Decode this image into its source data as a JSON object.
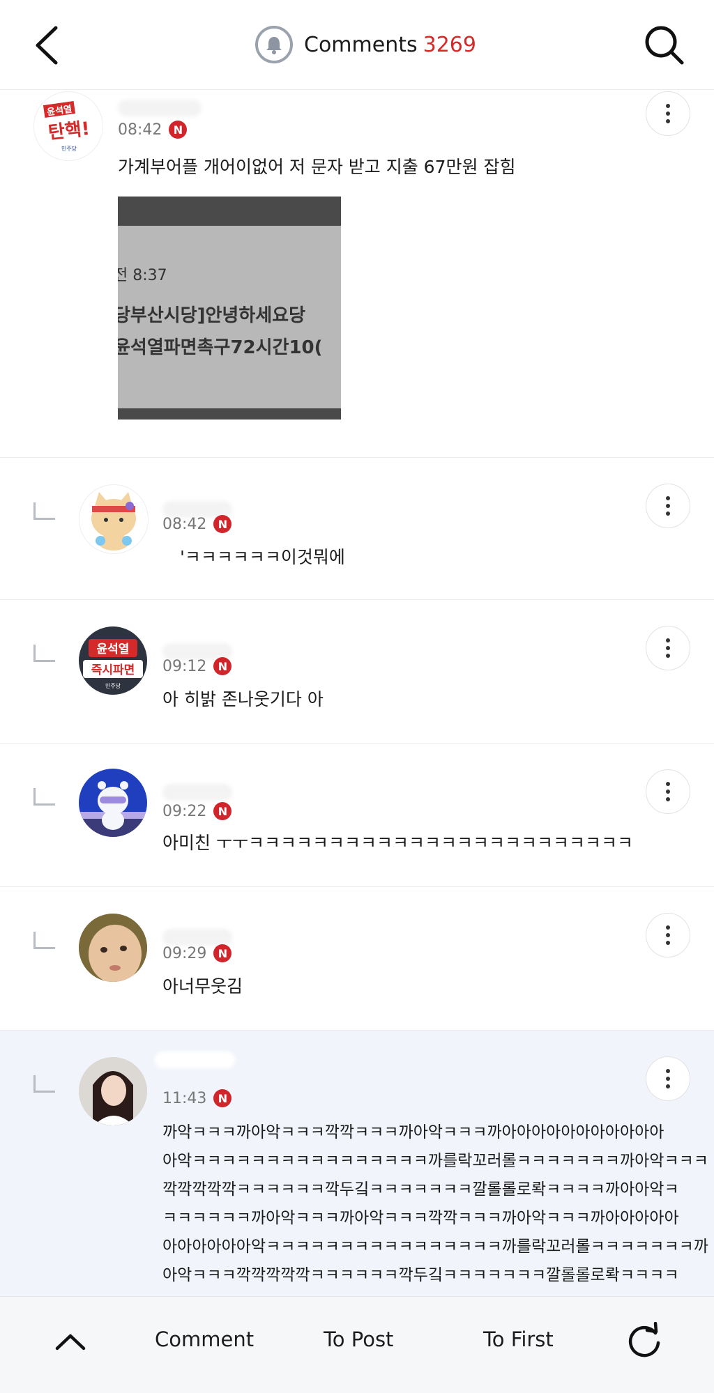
{
  "header": {
    "title": "Comments",
    "count": "3269"
  },
  "comments": [
    {
      "time": "08:42",
      "badge": "N",
      "text": "가계부어플 개어이없어 저 문자 받고 지출 67만원 잡힘",
      "image_lines": [
        "전 8:37",
        "당부산시당]안녕하세요당",
        "윤석열파면촉구72시간10("
      ],
      "avatar_text": [
        "윤석열",
        "탄핵!",
        "민주당"
      ]
    },
    {
      "time": "08:42",
      "badge": "N",
      "text": "'ㅋㅋㅋㅋㅋㅋ이것뭐에"
    },
    {
      "time": "09:12",
      "badge": "N",
      "text": "아 히밝 존나웃기다 아",
      "avatar_text": [
        "윤석열",
        "즉시파면",
        "민주당"
      ]
    },
    {
      "time": "09:22",
      "badge": "N",
      "text": "아미친 ㅜㅜㅋㅋㅋㅋㅋㅋㅋㅋㅋㅋㅋㅋㅋㅋㅋㅋㅋㅋㅋㅋㅋㅋㅋㅋ"
    },
    {
      "time": "09:29",
      "badge": "N",
      "text": "아너무웃김"
    },
    {
      "time": "11:43",
      "badge": "N",
      "lines": [
        "까악ㅋㅋㅋ까아악ㅋㅋㅋ깍깍ㅋㅋㅋ까아악ㅋㅋㅋ까아아아아아아아아아아아",
        "아악ㅋㅋㅋㅋㅋㅋㅋㅋㅋㅋㅋㅋㅋㅋㅋㅋ까를락꼬러롤ㅋㅋㅋㅋㅋㅋㅋ까아악ㅋㅋㅋ",
        "깍깍깍깍깍ㅋㅋㅋㅋㅋㅋ깍두깈ㅋㅋㅋㅋㅋㅋㅋ깔롤롤로롹ㅋㅋㅋㅋ까아아악ㅋ",
        "ㅋㅋㅋㅋㅋㅋ까아악ㅋㅋㅋ까아악ㅋㅋㅋ깍깍ㅋㅋㅋ까아악ㅋㅋㅋ까아아아아아",
        "아아아아아아악ㅋㅋㅋㅋㅋㅋㅋㅋㅋㅋㅋㅋㅋㅋㅋㅋ까를락꼬러롤ㅋㅋㅋㅋㅋㅋㅋ까",
        "아악ㅋㅋㅋ깍깍깍깍깍ㅋㅋㅋㅋㅋㅋ깍두깈ㅋㅋㅋㅋㅋㅋㅋ깔롤롤로롹ㅋㅋㅋㅋ"
      ]
    }
  ],
  "bottom_bar": {
    "comment": "Comment",
    "to_post": "To Post",
    "to_first": "To First"
  },
  "colors": {
    "accent_red": "#d32a2a",
    "badge_red": "#d0262b",
    "highlight_bg": "#f1f5fb"
  },
  "icons": [
    "back-arrow-icon",
    "bell-icon",
    "search-icon",
    "more-vertical-icon",
    "reply-arrow-icon",
    "chevron-up-icon",
    "refresh-icon"
  ]
}
